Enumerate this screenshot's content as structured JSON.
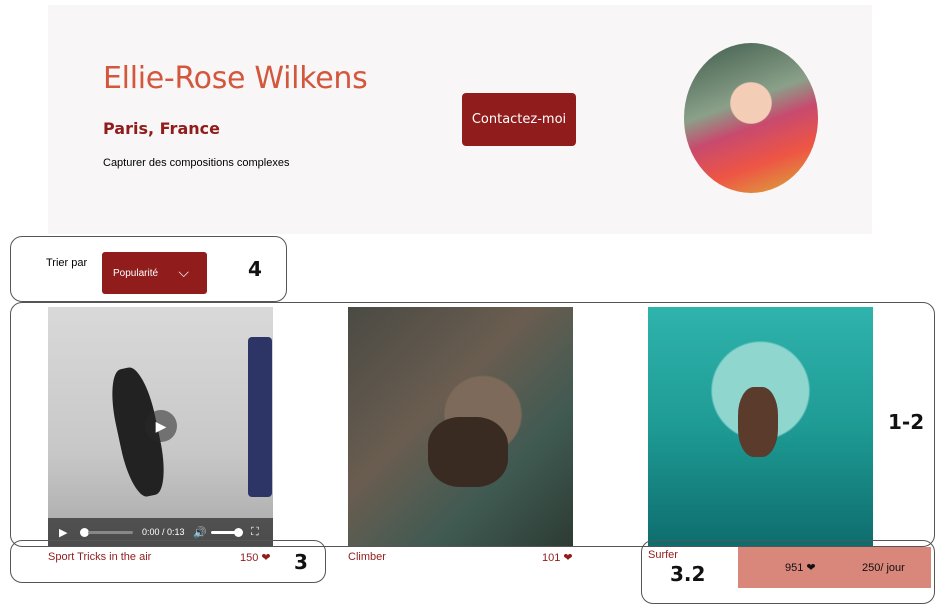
{
  "profile": {
    "name": "Ellie-Rose Wilkens",
    "location": "Paris, France",
    "tagline": "Capturer des compositions complexes",
    "contact_label": "Contactez-moi"
  },
  "sort": {
    "label": "Trier par",
    "selected": "Popularité",
    "chevron": "⌵"
  },
  "media": [
    {
      "title": "Sport Tricks in the air",
      "likes": "150 ❤",
      "type": "video",
      "video": {
        "time": "0:00 / 0:13"
      }
    },
    {
      "title": "Climber",
      "likes": "101 ❤",
      "type": "photo"
    },
    {
      "title": "Surfer",
      "likes": "",
      "type": "photo"
    }
  ],
  "summary": {
    "total_likes": "951 ❤",
    "price": "250/ jour"
  },
  "annotations": {
    "a1": "4",
    "a2": "1-2",
    "a3": "3",
    "a4": "3.2"
  },
  "colors": {
    "brand": "#901c1c",
    "accent": "#d3573c",
    "header_bg": "#f8f6f6",
    "summary_bg": "#d9867b"
  },
  "icons": {
    "play": "play-icon",
    "volume": "volume-icon",
    "fullscreen": "fullscreen-icon",
    "heart": "heart-icon",
    "chevron": "chevron-down-icon"
  }
}
